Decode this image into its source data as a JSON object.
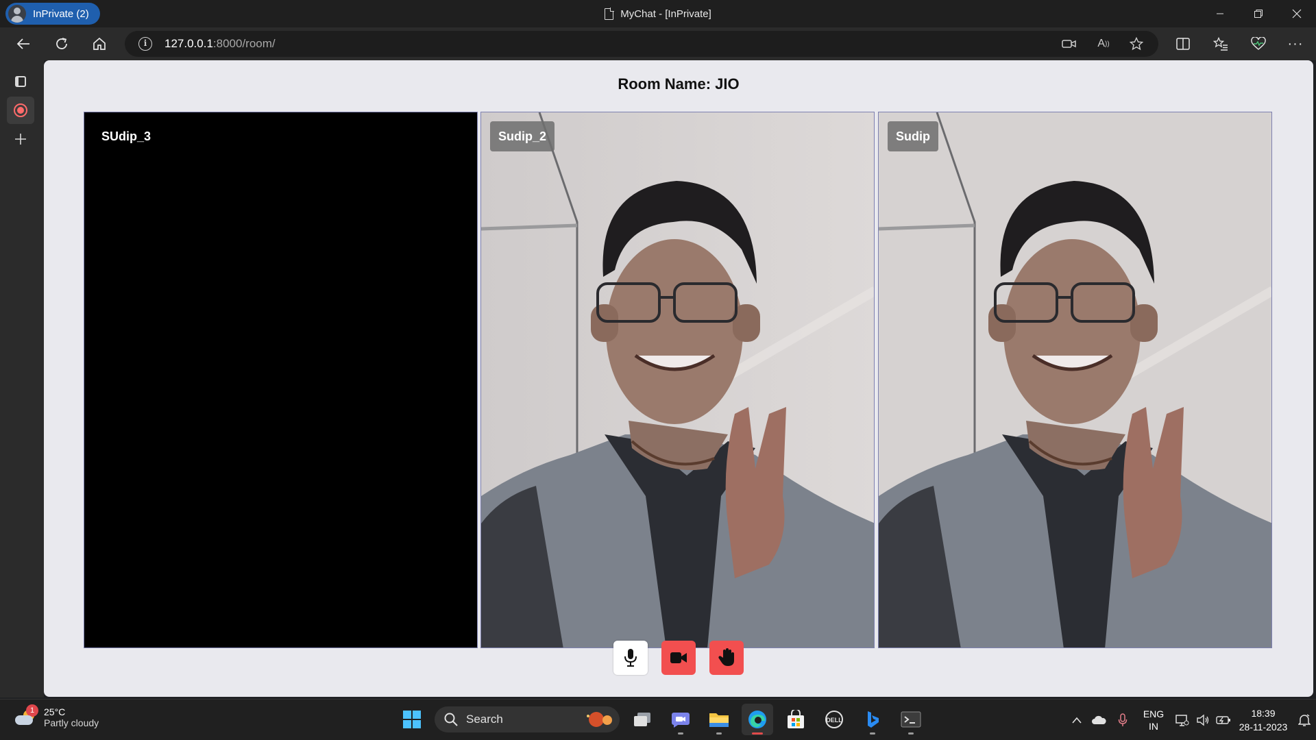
{
  "browser": {
    "profile_label": "InPrivate (2)",
    "window_title": "MyChat - [InPrivate]",
    "url_host": "127.0.0.1",
    "url_path": ":8000/room/"
  },
  "page": {
    "room_title": "Room Name: JIO",
    "participants": [
      {
        "name": "SUdip_3",
        "video": "off"
      },
      {
        "name": "Sudip_2",
        "video": "on"
      },
      {
        "name": "Sudip",
        "video": "on"
      }
    ],
    "controls": {
      "mic": "mic-icon",
      "camera": "camera-icon",
      "leave": "hand-icon"
    },
    "colors": {
      "control_red": "#f24f4f",
      "tile_border": "#7d80b0"
    }
  },
  "taskbar": {
    "weather_temp": "25°C",
    "weather_desc": "Partly cloudy",
    "weather_badge": "1",
    "search_label": "Search",
    "lang_line1": "ENG",
    "lang_line2": "IN",
    "time": "18:39",
    "date": "28-11-2023"
  }
}
